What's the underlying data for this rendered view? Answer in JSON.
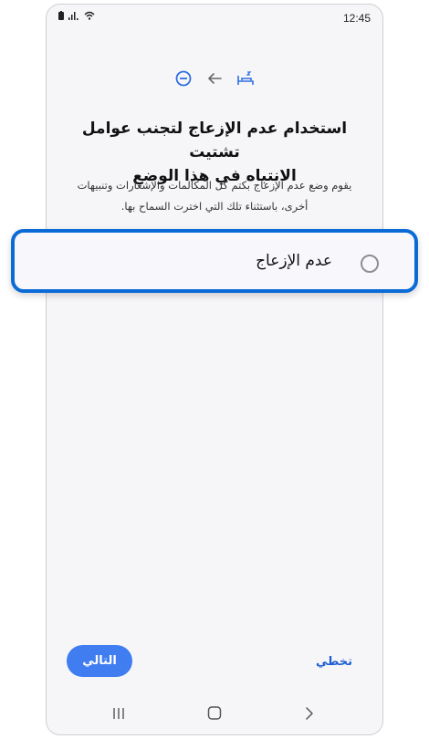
{
  "status_bar": {
    "time": "12:45"
  },
  "icons": [
    "do-not-disturb-icon",
    "back-arrow-icon",
    "sleep-icon"
  ],
  "page": {
    "title_line1": "استخدام عدم الإزعاج لتجنب عوامل تشتيت",
    "title_line2": "الانتباه في هذا الوضع",
    "desc_line1": "يقوم وضع عدم الإزعاج بكتم كل المكالمات والإشعارات وتنبيهات",
    "desc_line2": "أخرى، باستثناء تلك التي اخترت السماح بها."
  },
  "option": {
    "label": "عدم الإزعاج",
    "selected": false
  },
  "footer": {
    "next_label": "التالي",
    "skip_label": "تخطي"
  },
  "colors": {
    "accent": "#3f7df0",
    "highlight_border": "#0a6bd6",
    "link": "#1d5fd1"
  }
}
